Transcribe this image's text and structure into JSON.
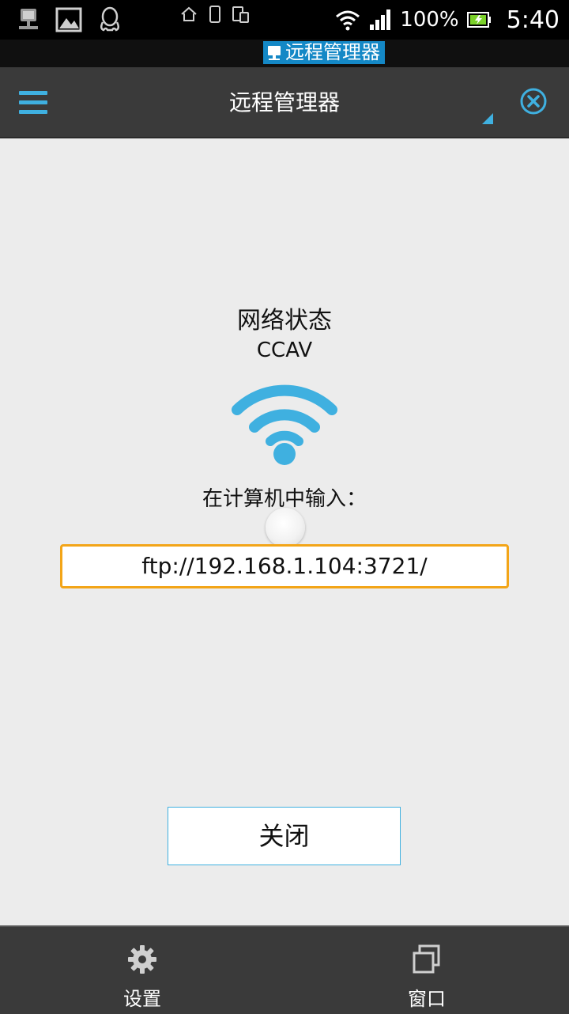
{
  "status_bar": {
    "icons_left": [
      "network-share-icon",
      "image-icon",
      "qq-icon"
    ],
    "battery_percent": "100%",
    "time": "5:40"
  },
  "task_strip": {
    "active_label": "远程管理器"
  },
  "action_bar": {
    "title": "远程管理器"
  },
  "content": {
    "network_status_label": "网络状态",
    "network_name": "CCAV",
    "hint": "在计算机中输入：",
    "address": "ftp://192.168.1.104:3721/",
    "close_button": "关闭"
  },
  "bottom_nav": {
    "settings": "设置",
    "windows": "窗口"
  },
  "colors": {
    "accent": "#3fb0e0",
    "highlight": "#f3a518",
    "bar": "#3a3a3a",
    "background": "#ececec"
  }
}
